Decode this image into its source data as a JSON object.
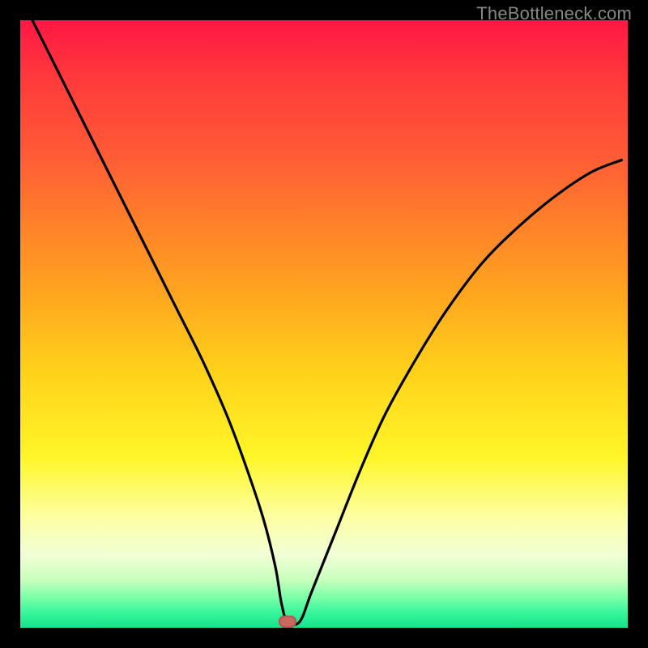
{
  "attribution": "TheBottleneck.com",
  "chart_data": {
    "type": "line",
    "title": "",
    "xlabel": "",
    "ylabel": "",
    "xlim": [
      0,
      100
    ],
    "ylim": [
      0,
      100
    ],
    "minimum_marker": {
      "x": 44,
      "y": 1
    },
    "series": [
      {
        "name": "bottleneck-curve",
        "x": [
          2,
          6,
          10,
          14,
          18,
          22,
          26,
          30,
          34,
          37,
          40,
          42,
          43,
          44,
          46,
          48,
          52,
          56,
          60,
          65,
          70,
          76,
          82,
          88,
          94,
          99
        ],
        "values": [
          100,
          92,
          84,
          76,
          68,
          60,
          52,
          44,
          35,
          27,
          18,
          10,
          4,
          1,
          1,
          6,
          16,
          26,
          35,
          44,
          52,
          60,
          66,
          71,
          75,
          77
        ]
      }
    ]
  },
  "colors": {
    "curve": "#000000",
    "marker": "#c9685e"
  }
}
